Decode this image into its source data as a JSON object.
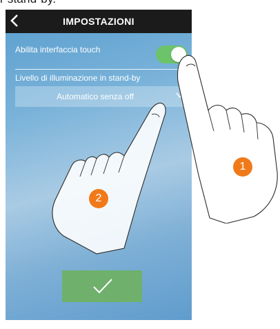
{
  "caption": "r stand-by.",
  "header": {
    "title": "IMPOSTAZIONI",
    "back_icon": "chevron-left-icon"
  },
  "settings": {
    "touch_label": "Abilita interfaccia touch",
    "touch_enabled": true,
    "standby_label": "Livello di illuminazione in stand-by",
    "standby_value": "Automatico senza off"
  },
  "confirm": {
    "icon": "checkmark-icon"
  },
  "colors": {
    "toggle_on": "#6cc36a",
    "confirm": "#6fb06c",
    "badge": "#f07a1a",
    "topbar": "#1b1b1b"
  },
  "badges": {
    "one": "1",
    "two": "2"
  }
}
